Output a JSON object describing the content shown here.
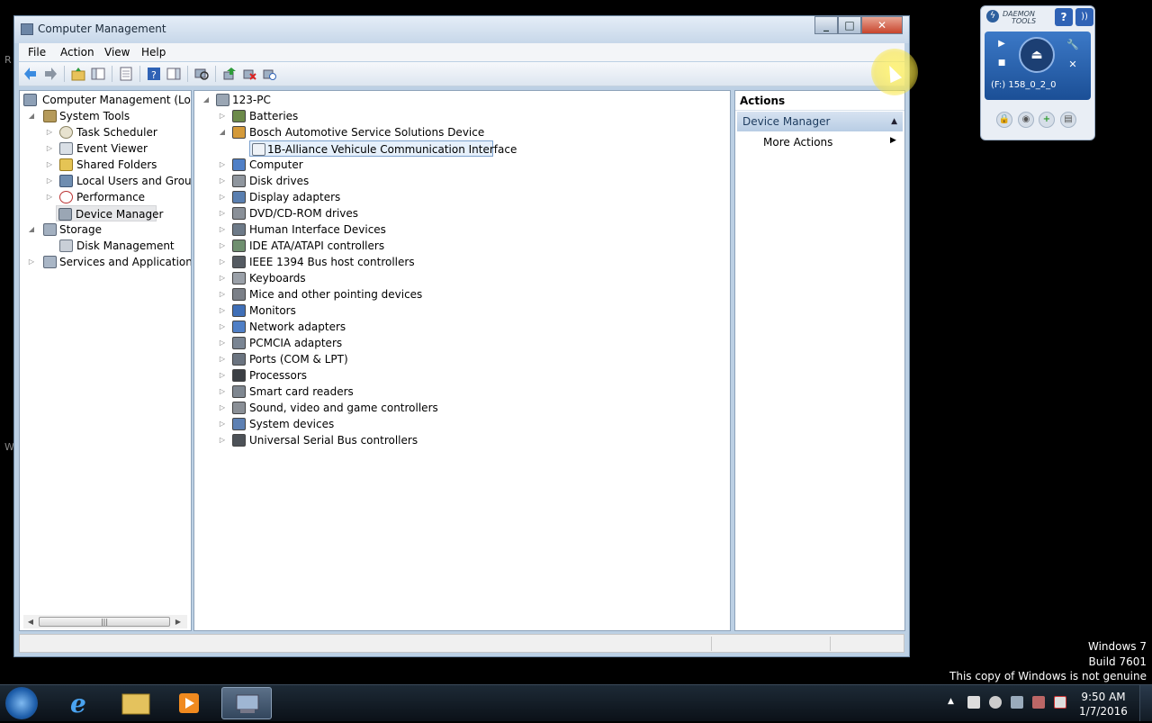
{
  "window": {
    "title": "Computer Management"
  },
  "menubar": [
    "File",
    "Action",
    "View",
    "Help"
  ],
  "left_tree": [
    {
      "label": "Computer Management (Local",
      "level": 0
    },
    {
      "label": "System Tools",
      "level": 1
    },
    {
      "label": "Task Scheduler",
      "level": 2
    },
    {
      "label": "Event Viewer",
      "level": 2
    },
    {
      "label": "Shared Folders",
      "level": 2
    },
    {
      "label": "Local Users and Groups",
      "level": 2
    },
    {
      "label": "Performance",
      "level": 2
    },
    {
      "label": "Device Manager",
      "level": 2,
      "selected": true
    },
    {
      "label": "Storage",
      "level": 1
    },
    {
      "label": "Disk Management",
      "level": 2
    },
    {
      "label": "Services and Applications",
      "level": 1
    }
  ],
  "device_tree": {
    "root": "123-PC",
    "categories": [
      "Batteries",
      "Bosch Automotive Service Solutions Device",
      "Computer",
      "Disk drives",
      "Display adapters",
      "DVD/CD-ROM drives",
      "Human Interface Devices",
      "IDE ATA/ATAPI controllers",
      "IEEE 1394 Bus host controllers",
      "Keyboards",
      "Mice and other pointing devices",
      "Monitors",
      "Network adapters",
      "PCMCIA adapters",
      "Ports (COM & LPT)",
      "Processors",
      "Smart card readers",
      "Sound, video and game controllers",
      "System devices",
      "Universal Serial Bus controllers"
    ],
    "expanded_child": "1B-Alliance Vehicule Communication Interface"
  },
  "actions": {
    "header": "Actions",
    "section": "Device Manager",
    "more": "More Actions"
  },
  "daemon": {
    "logo_line1": "DAEMON",
    "logo_line2": "TOOLS",
    "help": "?",
    "drive": "(F:) 158_0_2_0"
  },
  "watermark": {
    "line1": "Windows 7",
    "line2": "Build 7601",
    "line3": "This copy of Windows is not genuine"
  },
  "clock": {
    "time": "9:50 AM",
    "date": "1/7/2016"
  },
  "colors": {
    "selection_border": "#7da2ce",
    "close_button": "#c7442c",
    "taskbar": "#0b1118"
  }
}
